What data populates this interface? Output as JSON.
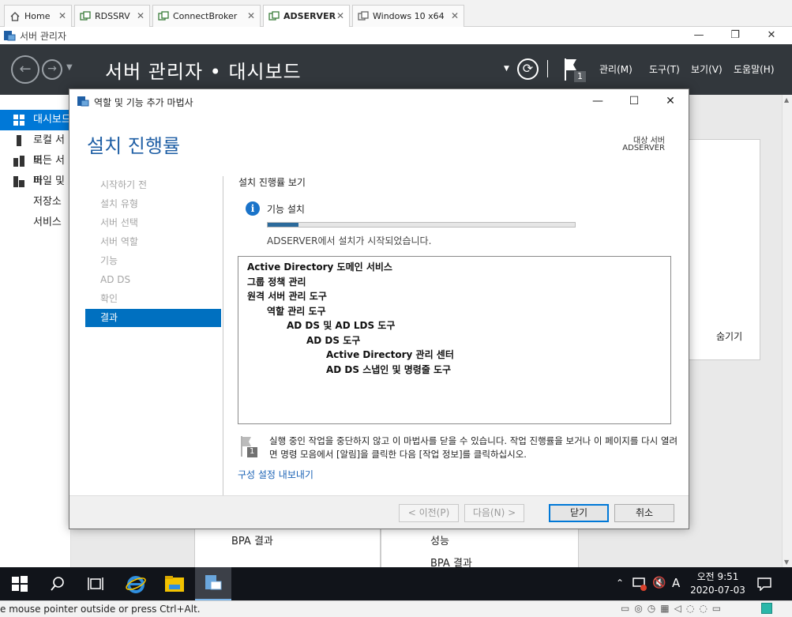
{
  "vm_tabs": [
    {
      "label": "Home"
    },
    {
      "label": "RDSSRV"
    },
    {
      "label": "ConnectBroker"
    },
    {
      "label": "ADSERVER"
    },
    {
      "label": "Windows 10 x64"
    }
  ],
  "window": {
    "title": "서버 관리자"
  },
  "header": {
    "breadcrumb": "서버 관리자 • 대시보드",
    "flag_badge": "1",
    "menu": [
      "관리(M)",
      "도구(T)",
      "보기(V)",
      "도움말(H)"
    ]
  },
  "nav": {
    "items": [
      {
        "label": "대시보드"
      },
      {
        "label": "로컬 서버"
      },
      {
        "label": "모든 서버"
      },
      {
        "label": "파일 및 저장소 서비스"
      }
    ]
  },
  "background": {
    "hide_label": "숨기기",
    "bpa_left": "BPA 결과",
    "perf_right": "성능",
    "bpa_right": "BPA 결과"
  },
  "wizard": {
    "title": "역할 및 기능 추가 마법사",
    "heading": "설치 진행률",
    "target_label": "대상 서버",
    "target_value": "ADSERVER",
    "steps": [
      "시작하기 전",
      "설치 유형",
      "서버 선택",
      "서버 역할",
      "기능",
      "AD DS",
      "확인",
      "결과"
    ],
    "current_step": "결과",
    "content_label": "설치 진행률 보기",
    "feature_install": "기능 설치",
    "progress_fraction": 0.1,
    "progress_message": "ADSERVER에서 설치가 시작되었습니다.",
    "results": [
      {
        "text": "Active Directory 도메인 서비스",
        "level": 0
      },
      {
        "text": "그룹 정책 관리",
        "level": 0
      },
      {
        "text": "원격 서버 관리 도구",
        "level": 0
      },
      {
        "text": "역할 관리 도구",
        "level": 1
      },
      {
        "text": "AD DS 및 AD LDS 도구",
        "level": 2
      },
      {
        "text": "AD DS 도구",
        "level": 3
      },
      {
        "text": "Active Directory 관리 센터",
        "level": 4
      },
      {
        "text": "AD DS 스냅인 및 명령줄 도구",
        "level": 4
      }
    ],
    "note": "실행 중인 작업을 중단하지 않고 이 마법사를 닫을 수 있습니다. 작업 진행률을 보거나 이 페이지를 다시 열려면 명령 모음에서 [알림]을 클릭한 다음 [작업 정보]를 클릭하십시오.",
    "note_flag_badge": "1",
    "export_link": "구성 설정 내보내기",
    "buttons": {
      "prev": "< 이전(P)",
      "next": "다음(N) >",
      "close": "닫기",
      "cancel": "취소"
    }
  },
  "taskbar": {
    "ime": "A",
    "time": "오전 9:51",
    "date": "2020-07-03"
  },
  "vm_status": {
    "message": "e mouse pointer outside or press Ctrl+Alt."
  },
  "colors": {
    "header_bg": "#32373c",
    "accent": "#0078d7",
    "heading": "#1f5fa5",
    "progress": "#2b6a9b",
    "link": "#1a62b5"
  }
}
